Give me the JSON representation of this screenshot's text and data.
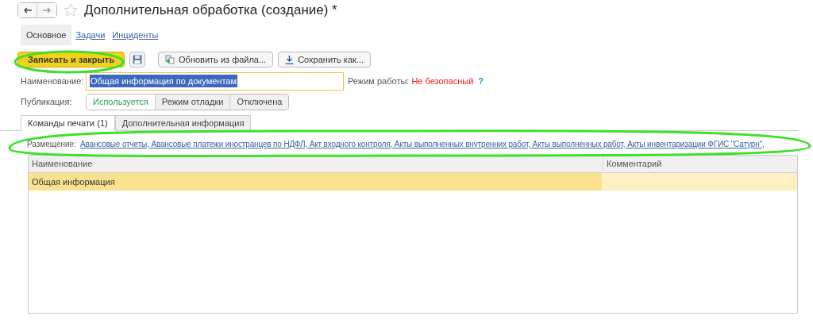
{
  "window": {
    "title": "Дополнительная обработка (создание) *"
  },
  "sections": [
    {
      "label": "Основное",
      "selected": true
    },
    {
      "label": "Задачи",
      "selected": false
    },
    {
      "label": "Инциденты",
      "selected": false
    }
  ],
  "toolbar": {
    "primary": "Записать и закрыть",
    "buttons": [
      {
        "kind": "icon"
      },
      {
        "kind": "refresh",
        "label": "Обновить из файла..."
      },
      {
        "kind": "download",
        "label": "Сохранить как..."
      }
    ]
  },
  "name_field": {
    "label": "Наименование:",
    "value": "Общая информация по документам"
  },
  "mode": {
    "label": "Режим работы:",
    "value": "Не безопасный",
    "help": "?"
  },
  "publication": {
    "label": "Публикация:",
    "options": [
      {
        "label": "Используется",
        "selected": true
      },
      {
        "label": "Режим отладки",
        "selected": false
      },
      {
        "label": "Отключена",
        "selected": false
      }
    ]
  },
  "tabs": [
    {
      "label": "Команды печати (1)",
      "selected": true
    },
    {
      "label": "Дополнительная информация",
      "selected": false
    }
  ],
  "placement": {
    "label": "Размещение:",
    "value": "Авансовые отчеты, Авансовые платежи иностранцев по НДФЛ, Акт входного контроля, Акты выполненных внутренних работ, Акты выполненных работ, Акты инвентаризации ФГИС \"Сатурн\","
  },
  "table": {
    "columns": [
      "Наименование",
      "Комментарий"
    ],
    "rows": [
      {
        "cells": [
          "Общая информация",
          ""
        ],
        "selected": true
      }
    ]
  }
}
